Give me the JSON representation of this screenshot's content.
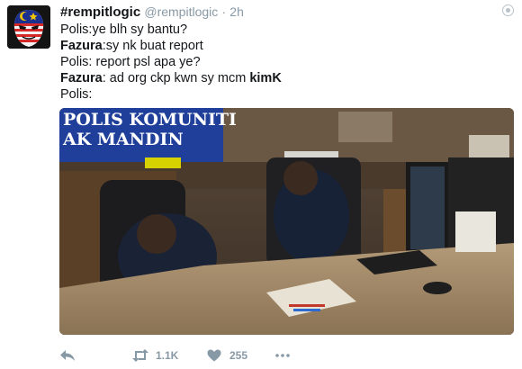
{
  "tweet": {
    "display_name": "#rempitlogic",
    "handle": "@rempitlogic",
    "separator": "·",
    "time": "2h",
    "lines": [
      {
        "parts": [
          {
            "t": "Polis:ye blh sy bantu?",
            "b": false
          }
        ]
      },
      {
        "parts": [
          {
            "t": "Fazura",
            "b": true
          },
          {
            "t": ":sy nk buat report",
            "b": false
          }
        ]
      },
      {
        "parts": [
          {
            "t": "Polis: report psl apa ye?",
            "b": false
          }
        ]
      },
      {
        "parts": [
          {
            "t": "Fazura",
            "b": true
          },
          {
            "t": ": ad org ckp kwn sy mcm ",
            "b": false
          },
          {
            "t": "kimK",
            "b": true
          }
        ]
      },
      {
        "parts": [
          {
            "t": "Polis:",
            "b": false
          }
        ]
      }
    ],
    "media": {
      "sign_line1": "POLIS KOMUNITI",
      "sign_line2": "AK MANDIN"
    },
    "actions": {
      "reply_icon": "reply-icon",
      "retweet_icon": "retweet-icon",
      "retweet_count": "1.1K",
      "like_icon": "heart-icon",
      "like_count": "255",
      "more_icon": "more-dots-icon"
    },
    "colors": {
      "text": "#14171a",
      "muted": "#8899a6",
      "flag_red": "#d62828",
      "flag_blue": "#1b2f8f",
      "flag_yellow": "#f2c500"
    }
  }
}
